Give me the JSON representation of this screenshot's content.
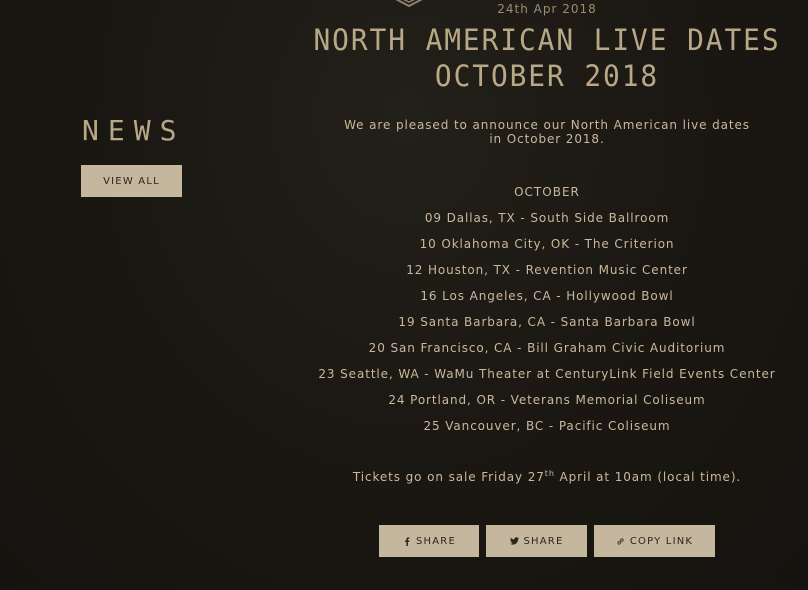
{
  "post": {
    "date": "24th Apr 2018",
    "title_line1": "NORTH AMERICAN LIVE DATES",
    "title_line2": "OCTOBER 2018",
    "intro": "We are pleased to announce our North American live dates in October 2018.",
    "month": "OCTOBER",
    "dates": [
      "09 Dallas, TX - South Side Ballroom",
      "10 Oklahoma City, OK - The Criterion",
      "12 Houston, TX - Revention Music Center",
      "16 Los Angeles, CA - Hollywood Bowl",
      "19 Santa Barbara, CA - Santa Barbara Bowl",
      "20 San Francisco, CA - Bill Graham Civic Auditorium",
      "23 Seattle, WA - WaMu Theater at CenturyLink Field Events Center",
      "24 Portland, OR - Veterans Memorial Coliseum",
      "25 Vancouver, BC - Pacific Coliseum"
    ],
    "tickets_before": "Tickets go on sale Friday 27",
    "tickets_sup": "th",
    "tickets_after": " April at 10am (local time)."
  },
  "sidebar": {
    "heading": "NEWS",
    "view_all_label": "VIEW ALL"
  },
  "share": {
    "facebook_label": "SHARE",
    "twitter_label": "SHARE",
    "copy_link_label": "COPY LINK",
    "facebook_icon": "facebook-icon",
    "twitter_icon": "twitter-icon",
    "link_icon": "link-icon"
  },
  "colors": {
    "background": "#1b1813",
    "text": "#c9b89c",
    "heading": "#b9a887",
    "button_bg": "#c5b79e",
    "button_text": "#2a251d"
  }
}
